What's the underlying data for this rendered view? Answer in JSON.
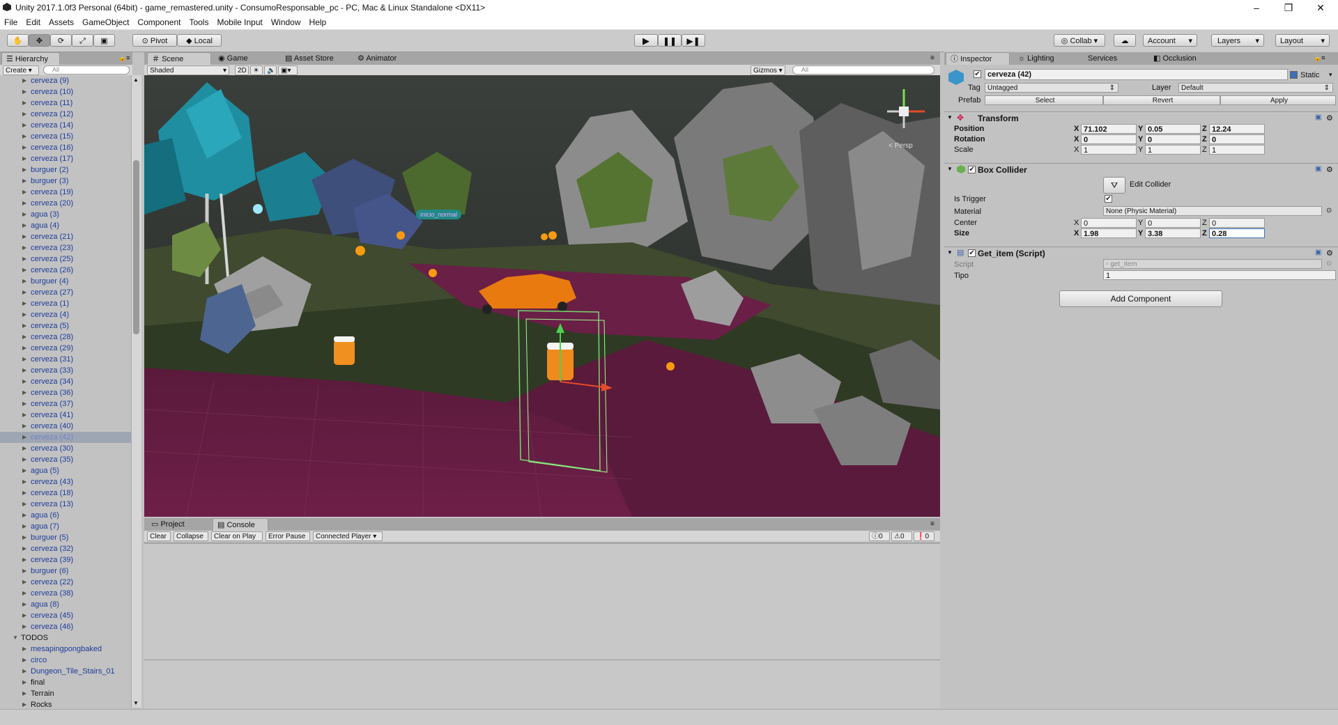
{
  "window": {
    "title": "Unity 2017.1.0f3 Personal (64bit) - game_remastered.unity - ConsumoResponsable_pc - PC, Mac & Linux Standalone <DX11>"
  },
  "menu": [
    "File",
    "Edit",
    "Assets",
    "GameObject",
    "Component",
    "Tools",
    "Mobile Input",
    "Window",
    "Help"
  ],
  "toolbar": {
    "pivot": "Pivot",
    "local": "Local",
    "collab": "Collab ▾",
    "account": "Account",
    "layers": "Layers",
    "layout": "Layout"
  },
  "hierarchy": {
    "tab": "Hierarchy",
    "create": "Create ▾",
    "search_placeholder": "All",
    "items": [
      {
        "label": "cerveza (9)",
        "type": "prefab"
      },
      {
        "label": "cerveza (10)",
        "type": "prefab"
      },
      {
        "label": "cerveza (11)",
        "type": "prefab"
      },
      {
        "label": "cerveza (12)",
        "type": "prefab"
      },
      {
        "label": "cerveza (14)",
        "type": "prefab"
      },
      {
        "label": "cerveza (15)",
        "type": "prefab"
      },
      {
        "label": "cerveza (16)",
        "type": "prefab"
      },
      {
        "label": "cerveza (17)",
        "type": "prefab"
      },
      {
        "label": "burguer (2)",
        "type": "prefab"
      },
      {
        "label": "burguer (3)",
        "type": "prefab"
      },
      {
        "label": "cerveza (19)",
        "type": "prefab"
      },
      {
        "label": "cerveza (20)",
        "type": "prefab"
      },
      {
        "label": "agua (3)",
        "type": "prefab"
      },
      {
        "label": "agua (4)",
        "type": "prefab"
      },
      {
        "label": "cerveza (21)",
        "type": "prefab"
      },
      {
        "label": "cerveza (23)",
        "type": "prefab"
      },
      {
        "label": "cerveza (25)",
        "type": "prefab"
      },
      {
        "label": "cerveza (26)",
        "type": "prefab"
      },
      {
        "label": "burguer (4)",
        "type": "prefab"
      },
      {
        "label": "cerveza (27)",
        "type": "prefab"
      },
      {
        "label": "cerveza (1)",
        "type": "prefab"
      },
      {
        "label": "cerveza (4)",
        "type": "prefab"
      },
      {
        "label": "cerveza (5)",
        "type": "prefab"
      },
      {
        "label": "cerveza (28)",
        "type": "prefab"
      },
      {
        "label": "cerveza (29)",
        "type": "prefab"
      },
      {
        "label": "cerveza (31)",
        "type": "prefab"
      },
      {
        "label": "cerveza (33)",
        "type": "prefab"
      },
      {
        "label": "cerveza (34)",
        "type": "prefab"
      },
      {
        "label": "cerveza (36)",
        "type": "prefab"
      },
      {
        "label": "cerveza (37)",
        "type": "prefab"
      },
      {
        "label": "cerveza (41)",
        "type": "prefab"
      },
      {
        "label": "cerveza (40)",
        "type": "prefab"
      },
      {
        "label": "cerveza (42)",
        "type": "selected"
      },
      {
        "label": "cerveza (30)",
        "type": "prefab"
      },
      {
        "label": "cerveza (35)",
        "type": "prefab"
      },
      {
        "label": "agua (5)",
        "type": "prefab"
      },
      {
        "label": "cerveza (43)",
        "type": "prefab"
      },
      {
        "label": "cerveza (18)",
        "type": "prefab"
      },
      {
        "label": "cerveza (13)",
        "type": "prefab"
      },
      {
        "label": "agua (6)",
        "type": "prefab"
      },
      {
        "label": "agua (7)",
        "type": "prefab"
      },
      {
        "label": "burguer (5)",
        "type": "prefab"
      },
      {
        "label": "cerveza (32)",
        "type": "prefab"
      },
      {
        "label": "cerveza (39)",
        "type": "prefab"
      },
      {
        "label": "burguer (6)",
        "type": "prefab"
      },
      {
        "label": "cerveza (22)",
        "type": "prefab"
      },
      {
        "label": "cerveza (38)",
        "type": "prefab"
      },
      {
        "label": "agua (8)",
        "type": "prefab"
      },
      {
        "label": "cerveza (45)",
        "type": "prefab"
      },
      {
        "label": "cerveza (46)",
        "type": "prefab"
      },
      {
        "label": "TODOS",
        "type": "root"
      },
      {
        "label": "mesapingpongbaked",
        "type": "prefab"
      },
      {
        "label": "circo",
        "type": "prefab"
      },
      {
        "label": "Dungeon_Tile_Stairs_01",
        "type": "prefab"
      },
      {
        "label": "final",
        "type": "normal"
      },
      {
        "label": "Terrain",
        "type": "normal"
      },
      {
        "label": "Rocks",
        "type": "normal"
      }
    ]
  },
  "scene": {
    "tabs": [
      "Scene",
      "Game",
      "Asset Store",
      "Animator"
    ],
    "shading": "Shaded",
    "mode2d": "2D",
    "gizmos": "Gizmos ▾",
    "search_placeholder": "All",
    "persp_label": "< Persp",
    "tag_label": "inicio_normal"
  },
  "console": {
    "tabs": [
      "Project",
      "Console"
    ],
    "buttons": [
      "Clear",
      "Collapse",
      "Clear on Play",
      "Error Pause",
      "Connected Player ▾"
    ],
    "counts": [
      "0",
      "0",
      "0"
    ]
  },
  "inspector": {
    "tabs": [
      "Inspector",
      "Lighting",
      "Services",
      "Occlusion"
    ],
    "object_name": "cerveza (42)",
    "static_label": "Static",
    "tag_label": "Tag",
    "tag_value": "Untagged",
    "layer_label": "Layer",
    "layer_value": "Default",
    "prefab_label": "Prefab",
    "prefab_select": "Select",
    "prefab_revert": "Revert",
    "prefab_apply": "Apply",
    "transform": {
      "title": "Transform",
      "position": {
        "label": "Position",
        "x": "71.102",
        "y": "0.05",
        "z": "12.24"
      },
      "rotation": {
        "label": "Rotation",
        "x": "0",
        "y": "0",
        "z": "0"
      },
      "scale": {
        "label": "Scale",
        "x": "1",
        "y": "1",
        "z": "1"
      }
    },
    "box_collider": {
      "title": "Box Collider",
      "edit_collider": "Edit Collider",
      "is_trigger": "Is Trigger",
      "material_label": "Material",
      "material_value": "None (Physic Material)",
      "center": {
        "label": "Center",
        "x": "0",
        "y": "0",
        "z": "0"
      },
      "size": {
        "label": "Size",
        "x": "1.98",
        "y": "3.38",
        "z": "0.28"
      }
    },
    "get_item": {
      "title": "Get_item (Script)",
      "script_label": "Script",
      "script_value": "get_item",
      "tipo_label": "Tipo",
      "tipo_value": "1"
    },
    "add_component": "Add Component"
  },
  "axes": {
    "x": "X",
    "y": "Y",
    "z": "Z"
  },
  "colors": {
    "prefab_text": "#1c3c9a",
    "selected_bg": "#9fa6b3",
    "road": "#6b1d45",
    "sky": "#2d3030"
  }
}
